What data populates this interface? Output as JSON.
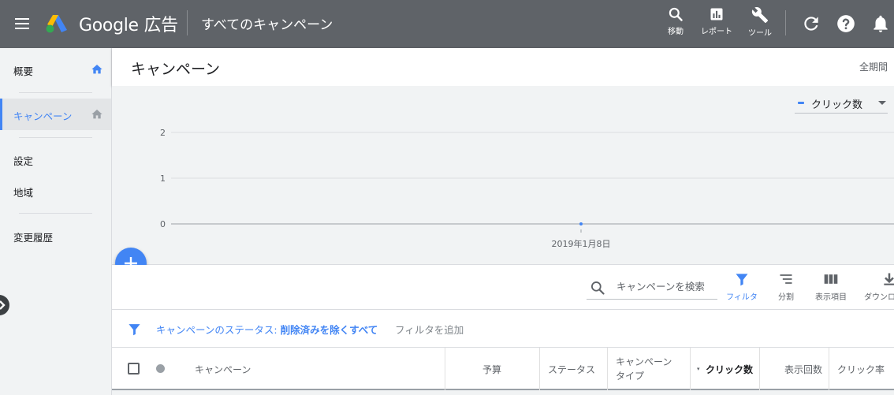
{
  "topbar": {
    "brand": "Google 広告",
    "context": "すべてのキャンペーン",
    "tools": [
      {
        "label": "移動",
        "icon": "search-icon"
      },
      {
        "label": "レポート",
        "icon": "reports-icon"
      },
      {
        "label": "ツール",
        "icon": "wrench-icon"
      }
    ]
  },
  "sidebar": {
    "items": [
      {
        "label": "概要"
      },
      {
        "label": "キャンペーン"
      },
      {
        "label": "設定"
      },
      {
        "label": "地域"
      },
      {
        "label": "変更履歴"
      }
    ]
  },
  "header": {
    "title": "キャンペーン",
    "date_range": "全期間"
  },
  "chart": {
    "metric": "クリック数"
  },
  "chart_data": {
    "type": "line",
    "series": [
      {
        "name": "クリック数",
        "x": [
          "2019年1月8日"
        ],
        "values": [
          0
        ]
      }
    ],
    "y_ticks": [
      "0",
      "1",
      "2"
    ],
    "x_ticks": [
      "2019年1月8日"
    ],
    "ylim": [
      0,
      2
    ],
    "grid": true,
    "color": "#4285f4"
  },
  "toolbar": {
    "search_placeholder": "キャンペーンを検索",
    "buttons": [
      {
        "label": "フィルタ"
      },
      {
        "label": "分割"
      },
      {
        "label": "表示項目"
      },
      {
        "label": "ダウンロ"
      }
    ]
  },
  "filter": {
    "chip_prefix": "キャンペーンのステータス:",
    "chip_value": "削除済みを除くすべて",
    "add": "フィルタを追加"
  },
  "table": {
    "columns": [
      "キャンペーン",
      "予算",
      "ステータス",
      "キャンペーン\nタイプ",
      "クリック数",
      "表示回数",
      "クリック率"
    ]
  },
  "colors": {
    "accent": "#4285f4",
    "topbar": "#5f6368"
  }
}
